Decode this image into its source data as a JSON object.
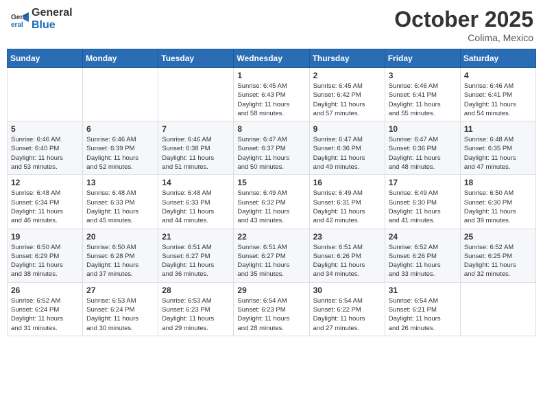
{
  "header": {
    "logo": {
      "general": "General",
      "blue": "Blue"
    },
    "title": "October 2025",
    "location": "Colima, Mexico"
  },
  "days_of_week": [
    "Sunday",
    "Monday",
    "Tuesday",
    "Wednesday",
    "Thursday",
    "Friday",
    "Saturday"
  ],
  "weeks": [
    [
      {
        "day": "",
        "info": ""
      },
      {
        "day": "",
        "info": ""
      },
      {
        "day": "",
        "info": ""
      },
      {
        "day": "1",
        "info": "Sunrise: 6:45 AM\nSunset: 6:43 PM\nDaylight: 11 hours\nand 58 minutes."
      },
      {
        "day": "2",
        "info": "Sunrise: 6:45 AM\nSunset: 6:42 PM\nDaylight: 11 hours\nand 57 minutes."
      },
      {
        "day": "3",
        "info": "Sunrise: 6:46 AM\nSunset: 6:41 PM\nDaylight: 11 hours\nand 55 minutes."
      },
      {
        "day": "4",
        "info": "Sunrise: 6:46 AM\nSunset: 6:41 PM\nDaylight: 11 hours\nand 54 minutes."
      }
    ],
    [
      {
        "day": "5",
        "info": "Sunrise: 6:46 AM\nSunset: 6:40 PM\nDaylight: 11 hours\nand 53 minutes."
      },
      {
        "day": "6",
        "info": "Sunrise: 6:46 AM\nSunset: 6:39 PM\nDaylight: 11 hours\nand 52 minutes."
      },
      {
        "day": "7",
        "info": "Sunrise: 6:46 AM\nSunset: 6:38 PM\nDaylight: 11 hours\nand 51 minutes."
      },
      {
        "day": "8",
        "info": "Sunrise: 6:47 AM\nSunset: 6:37 PM\nDaylight: 11 hours\nand 50 minutes."
      },
      {
        "day": "9",
        "info": "Sunrise: 6:47 AM\nSunset: 6:36 PM\nDaylight: 11 hours\nand 49 minutes."
      },
      {
        "day": "10",
        "info": "Sunrise: 6:47 AM\nSunset: 6:36 PM\nDaylight: 11 hours\nand 48 minutes."
      },
      {
        "day": "11",
        "info": "Sunrise: 6:48 AM\nSunset: 6:35 PM\nDaylight: 11 hours\nand 47 minutes."
      }
    ],
    [
      {
        "day": "12",
        "info": "Sunrise: 6:48 AM\nSunset: 6:34 PM\nDaylight: 11 hours\nand 46 minutes."
      },
      {
        "day": "13",
        "info": "Sunrise: 6:48 AM\nSunset: 6:33 PM\nDaylight: 11 hours\nand 45 minutes."
      },
      {
        "day": "14",
        "info": "Sunrise: 6:48 AM\nSunset: 6:33 PM\nDaylight: 11 hours\nand 44 minutes."
      },
      {
        "day": "15",
        "info": "Sunrise: 6:49 AM\nSunset: 6:32 PM\nDaylight: 11 hours\nand 43 minutes."
      },
      {
        "day": "16",
        "info": "Sunrise: 6:49 AM\nSunset: 6:31 PM\nDaylight: 11 hours\nand 42 minutes."
      },
      {
        "day": "17",
        "info": "Sunrise: 6:49 AM\nSunset: 6:30 PM\nDaylight: 11 hours\nand 41 minutes."
      },
      {
        "day": "18",
        "info": "Sunrise: 6:50 AM\nSunset: 6:30 PM\nDaylight: 11 hours\nand 39 minutes."
      }
    ],
    [
      {
        "day": "19",
        "info": "Sunrise: 6:50 AM\nSunset: 6:29 PM\nDaylight: 11 hours\nand 38 minutes."
      },
      {
        "day": "20",
        "info": "Sunrise: 6:50 AM\nSunset: 6:28 PM\nDaylight: 11 hours\nand 37 minutes."
      },
      {
        "day": "21",
        "info": "Sunrise: 6:51 AM\nSunset: 6:27 PM\nDaylight: 11 hours\nand 36 minutes."
      },
      {
        "day": "22",
        "info": "Sunrise: 6:51 AM\nSunset: 6:27 PM\nDaylight: 11 hours\nand 35 minutes."
      },
      {
        "day": "23",
        "info": "Sunrise: 6:51 AM\nSunset: 6:26 PM\nDaylight: 11 hours\nand 34 minutes."
      },
      {
        "day": "24",
        "info": "Sunrise: 6:52 AM\nSunset: 6:26 PM\nDaylight: 11 hours\nand 33 minutes."
      },
      {
        "day": "25",
        "info": "Sunrise: 6:52 AM\nSunset: 6:25 PM\nDaylight: 11 hours\nand 32 minutes."
      }
    ],
    [
      {
        "day": "26",
        "info": "Sunrise: 6:52 AM\nSunset: 6:24 PM\nDaylight: 11 hours\nand 31 minutes."
      },
      {
        "day": "27",
        "info": "Sunrise: 6:53 AM\nSunset: 6:24 PM\nDaylight: 11 hours\nand 30 minutes."
      },
      {
        "day": "28",
        "info": "Sunrise: 6:53 AM\nSunset: 6:23 PM\nDaylight: 11 hours\nand 29 minutes."
      },
      {
        "day": "29",
        "info": "Sunrise: 6:54 AM\nSunset: 6:23 PM\nDaylight: 11 hours\nand 28 minutes."
      },
      {
        "day": "30",
        "info": "Sunrise: 6:54 AM\nSunset: 6:22 PM\nDaylight: 11 hours\nand 27 minutes."
      },
      {
        "day": "31",
        "info": "Sunrise: 6:54 AM\nSunset: 6:21 PM\nDaylight: 11 hours\nand 26 minutes."
      },
      {
        "day": "",
        "info": ""
      }
    ]
  ]
}
